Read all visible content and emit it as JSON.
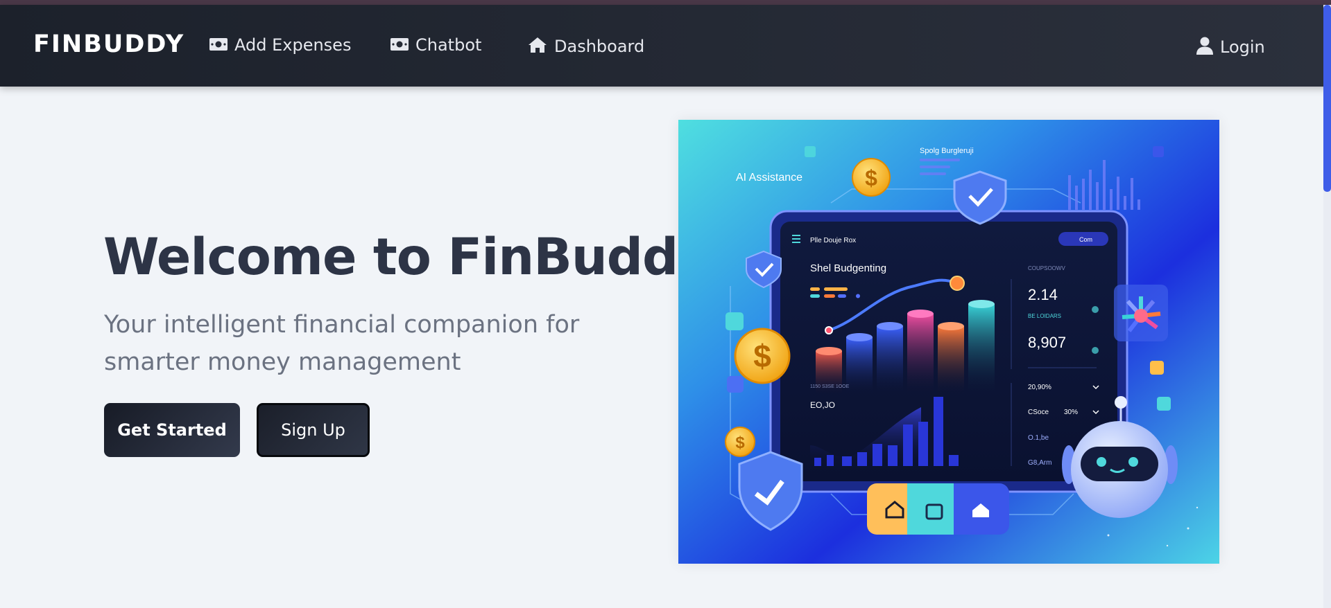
{
  "navbar": {
    "brand": "FINBUDDY",
    "links": [
      {
        "label": "Add Expenses",
        "icon": "money-bill-icon"
      },
      {
        "label": "Chatbot",
        "icon": "money-bill-icon"
      },
      {
        "label": "Dashboard",
        "icon": "home-icon"
      }
    ],
    "login": {
      "label": "Login",
      "icon": "user-icon"
    }
  },
  "hero": {
    "title": "Welcome to FinBuddy",
    "subtitle": "Your intelligent financial companion for smarter money management",
    "buttons": {
      "get_started": "Get Started",
      "sign_up": "Sign Up"
    }
  },
  "illustration": {
    "ai_label": "AI Assistance",
    "top_label": "Spolg Burgleruji",
    "panel_header": "Plle Douje Rox",
    "panel_button": "Com",
    "chart_title": "Shel Budgenting",
    "stat_header": "COUPSOOWV",
    "stat_1": "2.14",
    "stat_1_label": "BE LOIDARS",
    "stat_2": "8,907",
    "bottom_header": "1150 S3SE 1OOE",
    "bottom_value": "EO,JO",
    "row_1": "20,90%",
    "row_2a": "CSoce",
    "row_2b": "30%",
    "row_3": "O.1,be",
    "row_4": "G8,Arm",
    "colors": {
      "accent_teal": "#4fd8dc",
      "accent_blue": "#1f32e0",
      "gold": "#f5b829"
    }
  }
}
